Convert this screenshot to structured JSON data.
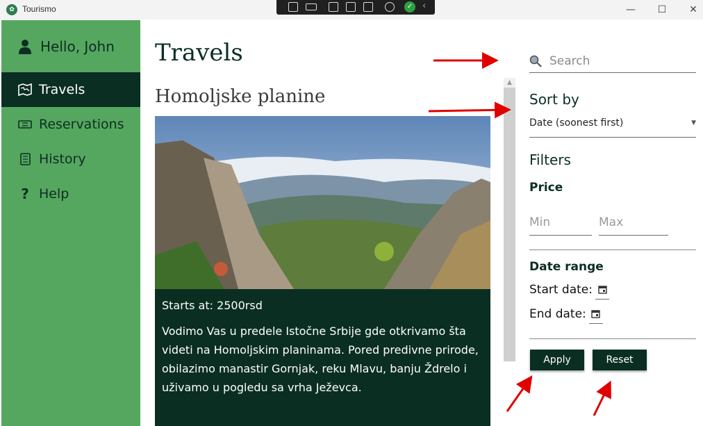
{
  "window": {
    "title": "Tourismo"
  },
  "sidebar": {
    "user_greeting": "Hello, John",
    "items": [
      {
        "label": "Travels",
        "icon": "map-icon",
        "active": true
      },
      {
        "label": "Reservations",
        "icon": "ticket-icon",
        "active": false
      },
      {
        "label": "History",
        "icon": "scroll-icon",
        "active": false
      },
      {
        "label": "Help",
        "icon": "question-icon",
        "active": false
      }
    ]
  },
  "main": {
    "title": "Travels",
    "travels": [
      {
        "name": "Homoljske planine",
        "price": "Starts at: 2500rsd",
        "description": "Vodimo Vas u predele Istočne Srbije gde otkrivamo šta videti na Homoljskim planinama. Pored predivne prirode, obilazimo manastir Gornjak, reku Mlavu, banju Ždrelo i uživamo u pogledu sa vrha Ježevca."
      }
    ]
  },
  "panel": {
    "search_placeholder": "Search",
    "sort_heading": "Sort by",
    "sort_selected": "Date (soonest first)",
    "filters_heading": "Filters",
    "price_heading": "Price",
    "min_placeholder": "Min",
    "max_placeholder": "Max",
    "date_range_heading": "Date range",
    "start_date_label": "Start date:",
    "end_date_label": "End date:",
    "apply_label": "Apply",
    "reset_label": "Reset"
  },
  "colors": {
    "sidebar": "#55a760",
    "dark": "#0a2e22",
    "annotation": "#e00000"
  }
}
